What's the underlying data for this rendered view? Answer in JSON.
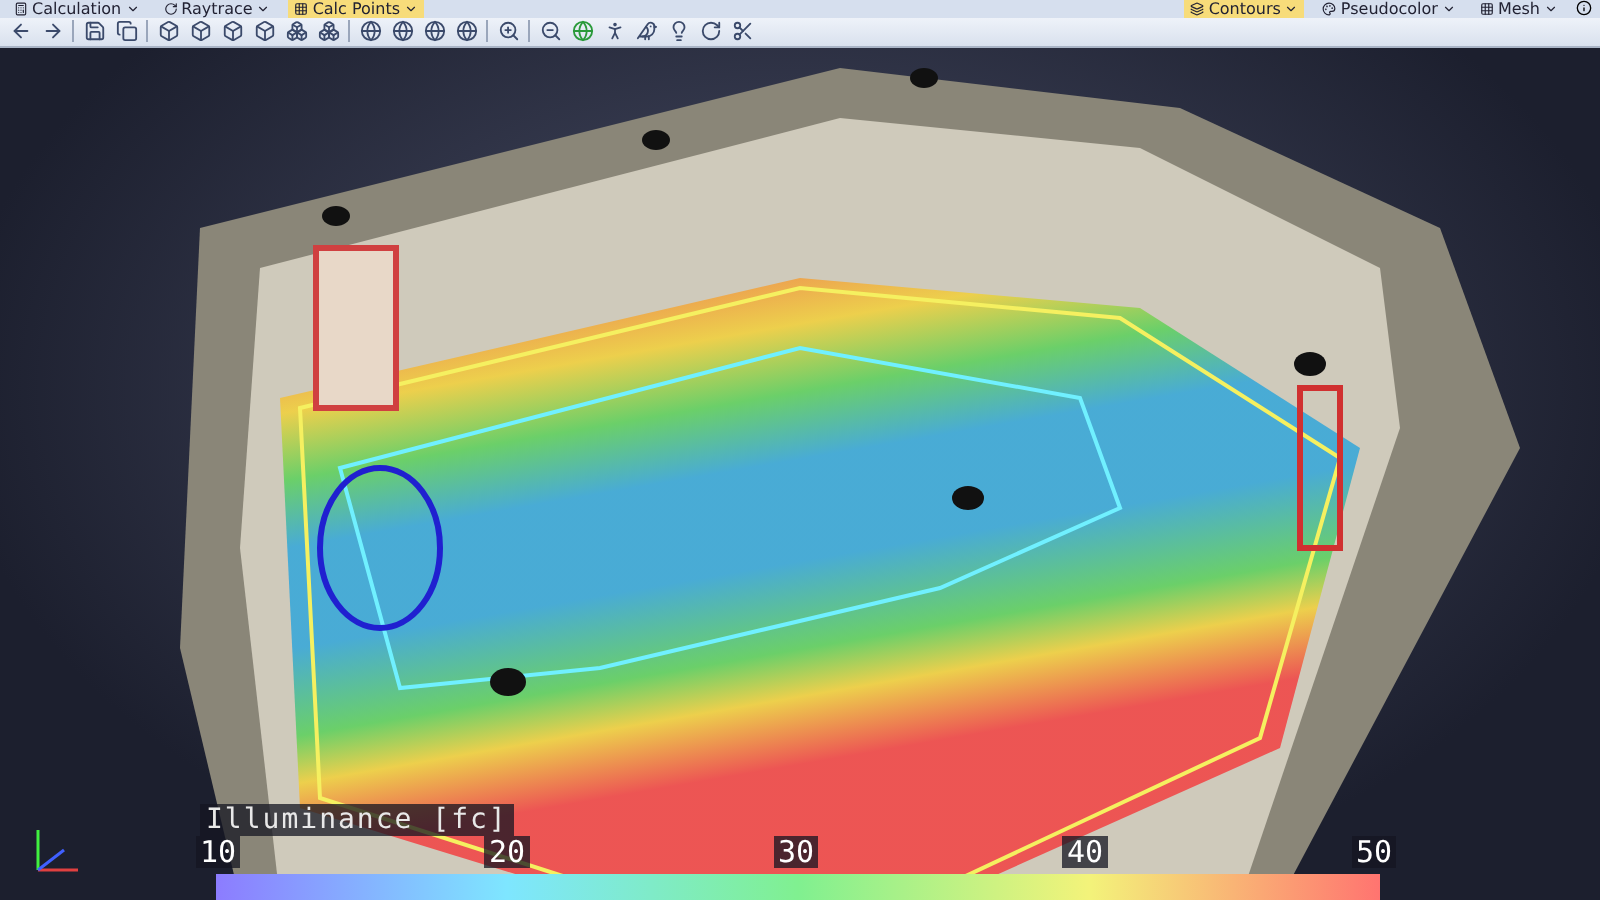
{
  "toolbar_menus": [
    {
      "label": "Calculation",
      "selected": false
    },
    {
      "label": "Raytrace",
      "selected": false
    },
    {
      "label": "Calc Points",
      "selected": true
    }
  ],
  "display_menus": [
    {
      "label": "Contours",
      "selected": true
    },
    {
      "label": "Pseudocolor",
      "selected": false
    },
    {
      "label": "Mesh",
      "selected": false
    }
  ],
  "legend": {
    "title": "Illuminance [fc]",
    "ticks": [
      "10",
      "20",
      "30",
      "40",
      "50"
    ]
  }
}
